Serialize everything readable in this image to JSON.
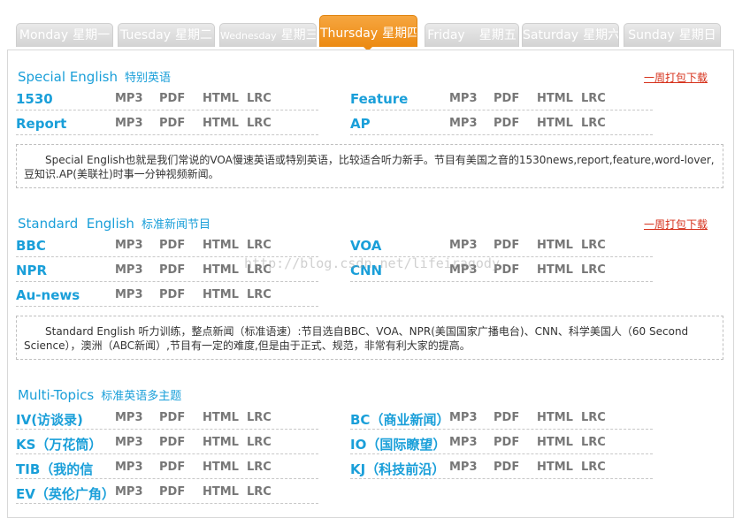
{
  "tabs": [
    {
      "en": "Monday",
      "cn": "星期一"
    },
    {
      "en": "Tuesday",
      "cn": "星期二"
    },
    {
      "en": "Wednesday",
      "cn": "星期三"
    },
    {
      "en": "Thursday",
      "cn": "星期四"
    },
    {
      "en": "Friday",
      "cn": "星期五"
    },
    {
      "en": "Saturday",
      "cn": "星期六"
    },
    {
      "en": "Sunday",
      "cn": "星期日"
    }
  ],
  "active_tab_index": 3,
  "colors": {
    "accent": "#ec8a12",
    "link_blue": "#1a9fd9",
    "download_red": "#d6311b"
  },
  "formats": [
    "MP3",
    "PDF",
    "HTML",
    "LRC"
  ],
  "sections": [
    {
      "title": "Special English",
      "subtitle": "特别英语",
      "download": "一周打包下载",
      "programs": [
        "1530",
        "Feature",
        "Report",
        "AP"
      ],
      "desc": "Special English也就是我们常说的VOA慢速英语或特别英语，比较适合听力新手。节目有美国之音的1530news,report,feature,word-lover,豆知识.AP(美联社)时事一分钟视频新闻。"
    },
    {
      "title": "Standard  English",
      "subtitle": "标准新闻节目",
      "download": "一周打包下载",
      "programs": [
        "BBC",
        "VOA",
        "NPR",
        "CNN",
        "Au-news"
      ],
      "desc": "Standard English 听力训练，整点新闻（标准语速）:节目选自BBC、VOA、NPR(美国国家广播电台)、CNN、科学美国人（60 Second Science），澳洲（ABC新闻）,节目有一定的难度,但是由于正式、规范，非常有利大家的提高。"
    },
    {
      "title": "Multi-Topics",
      "subtitle": "标准英语多主题",
      "programs": [
        "IV(访谈录)",
        "BC（商业新闻）",
        "KS（万花筒）",
        "IO（国际瞭望）",
        "TIB（我的信",
        "KJ（科技前沿）",
        "EV（英伦广角）"
      ]
    }
  ],
  "watermark": "http://blog.csdn.net/lifeiragody"
}
